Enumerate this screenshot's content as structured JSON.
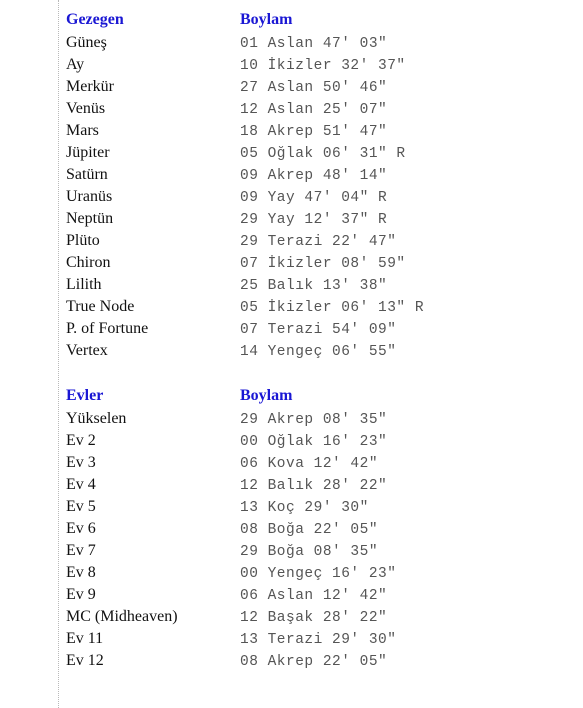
{
  "page": {
    "background_color": "#ffffff",
    "header_color": "#1a17d4",
    "name_color": "#111111",
    "value_color": "#555555",
    "divider_color": "#b9b9b9"
  },
  "sections": [
    {
      "id": "planets",
      "header": {
        "name": "Gezegen",
        "value": "Boylam"
      },
      "rows": [
        {
          "name": "Güneş",
          "value": "01 Aslan 47' 03\""
        },
        {
          "name": "Ay",
          "value": "10 İkizler 32' 37\""
        },
        {
          "name": "Merkür",
          "value": "27 Aslan 50' 46\""
        },
        {
          "name": "Venüs",
          "value": "12 Aslan 25' 07\""
        },
        {
          "name": "Mars",
          "value": "18 Akrep 51' 47\""
        },
        {
          "name": "Jüpiter",
          "value": "05 Oğlak 06' 31\" R"
        },
        {
          "name": "Satürn",
          "value": "09 Akrep 48' 14\""
        },
        {
          "name": "Uranüs",
          "value": "09 Yay 47' 04\" R"
        },
        {
          "name": "Neptün",
          "value": "29 Yay 12' 37\" R"
        },
        {
          "name": "Plüto",
          "value": "29 Terazi 22' 47\""
        },
        {
          "name": "Chiron",
          "value": "07 İkizler 08' 59\""
        },
        {
          "name": "Lilith",
          "value": "25 Balık 13' 38\""
        },
        {
          "name": "True Node",
          "value": "05 İkizler 06' 13\" R"
        },
        {
          "name": "P. of Fortune",
          "value": "07 Terazi 54' 09\""
        },
        {
          "name": "Vertex",
          "value": "14 Yengeç 06' 55\""
        }
      ]
    },
    {
      "id": "houses",
      "header": {
        "name": "Evler",
        "value": "Boylam"
      },
      "rows": [
        {
          "name": "Yükselen",
          "value": "29 Akrep 08' 35\""
        },
        {
          "name": "Ev 2",
          "value": "00 Oğlak 16' 23\""
        },
        {
          "name": "Ev 3",
          "value": "06 Kova 12' 42\""
        },
        {
          "name": "Ev 4",
          "value": "12 Balık 28' 22\""
        },
        {
          "name": "Ev 5",
          "value": "13 Koç 29' 30\""
        },
        {
          "name": "Ev 6",
          "value": "08 Boğa 22' 05\""
        },
        {
          "name": "Ev 7",
          "value": "29 Boğa 08' 35\""
        },
        {
          "name": "Ev 8",
          "value": "00 Yengeç 16' 23\""
        },
        {
          "name": "Ev 9",
          "value": "06 Aslan 12' 42\""
        },
        {
          "name": "MC (Midheaven)",
          "value": "12 Başak 28' 22\""
        },
        {
          "name": "Ev 11",
          "value": "13 Terazi 29' 30\""
        },
        {
          "name": "Ev 12",
          "value": "08 Akrep 22' 05\""
        }
      ]
    }
  ]
}
